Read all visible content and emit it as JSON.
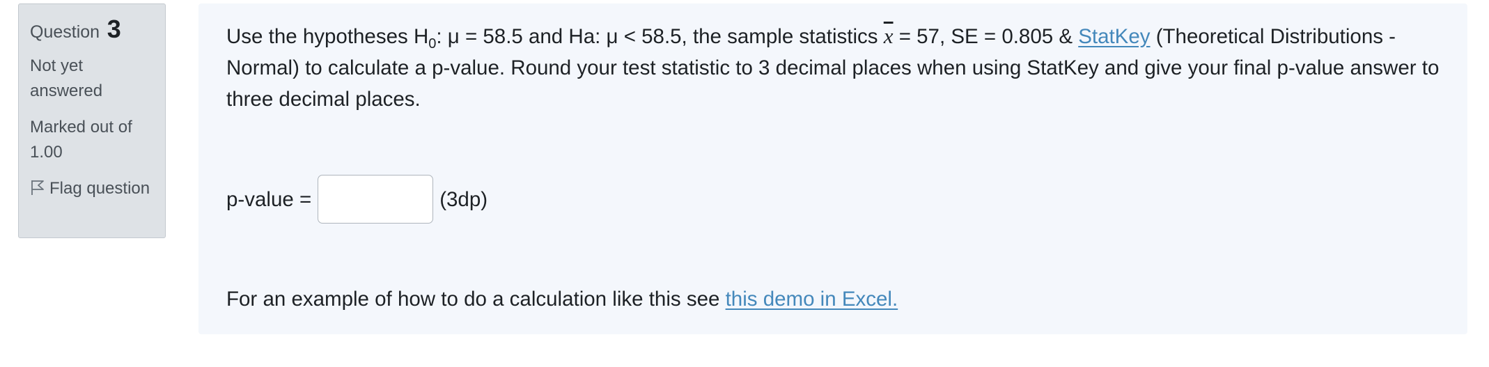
{
  "info": {
    "question_label": "Question",
    "question_number": "3",
    "state": "Not yet answered",
    "grade": "Marked out of 1.00",
    "flag_label": "Flag question"
  },
  "question": {
    "part1": "Use the hypotheses H",
    "h0_sub": "0",
    "part2": ": μ = 58.5 and Ha: μ < 58.5, the sample statistics ",
    "xbar": "x",
    "part3": " = 57, SE = 0.805 & ",
    "statkey_link": "StatKey",
    "part4": " (Theoretical Distributions - Normal) to calculate a p-value. Round your test statistic to 3 decimal places when using StatKey and give your final p-value answer to three decimal places."
  },
  "answer": {
    "label": "p-value =",
    "value": "",
    "placeholder": "",
    "suffix": "(3dp)"
  },
  "demo": {
    "text": "For an example of how to do a calculation like this see ",
    "link": "this demo in Excel."
  },
  "colors": {
    "info_bg": "#dee2e6",
    "content_bg": "#f4f7fc",
    "link": "#4488bb"
  }
}
